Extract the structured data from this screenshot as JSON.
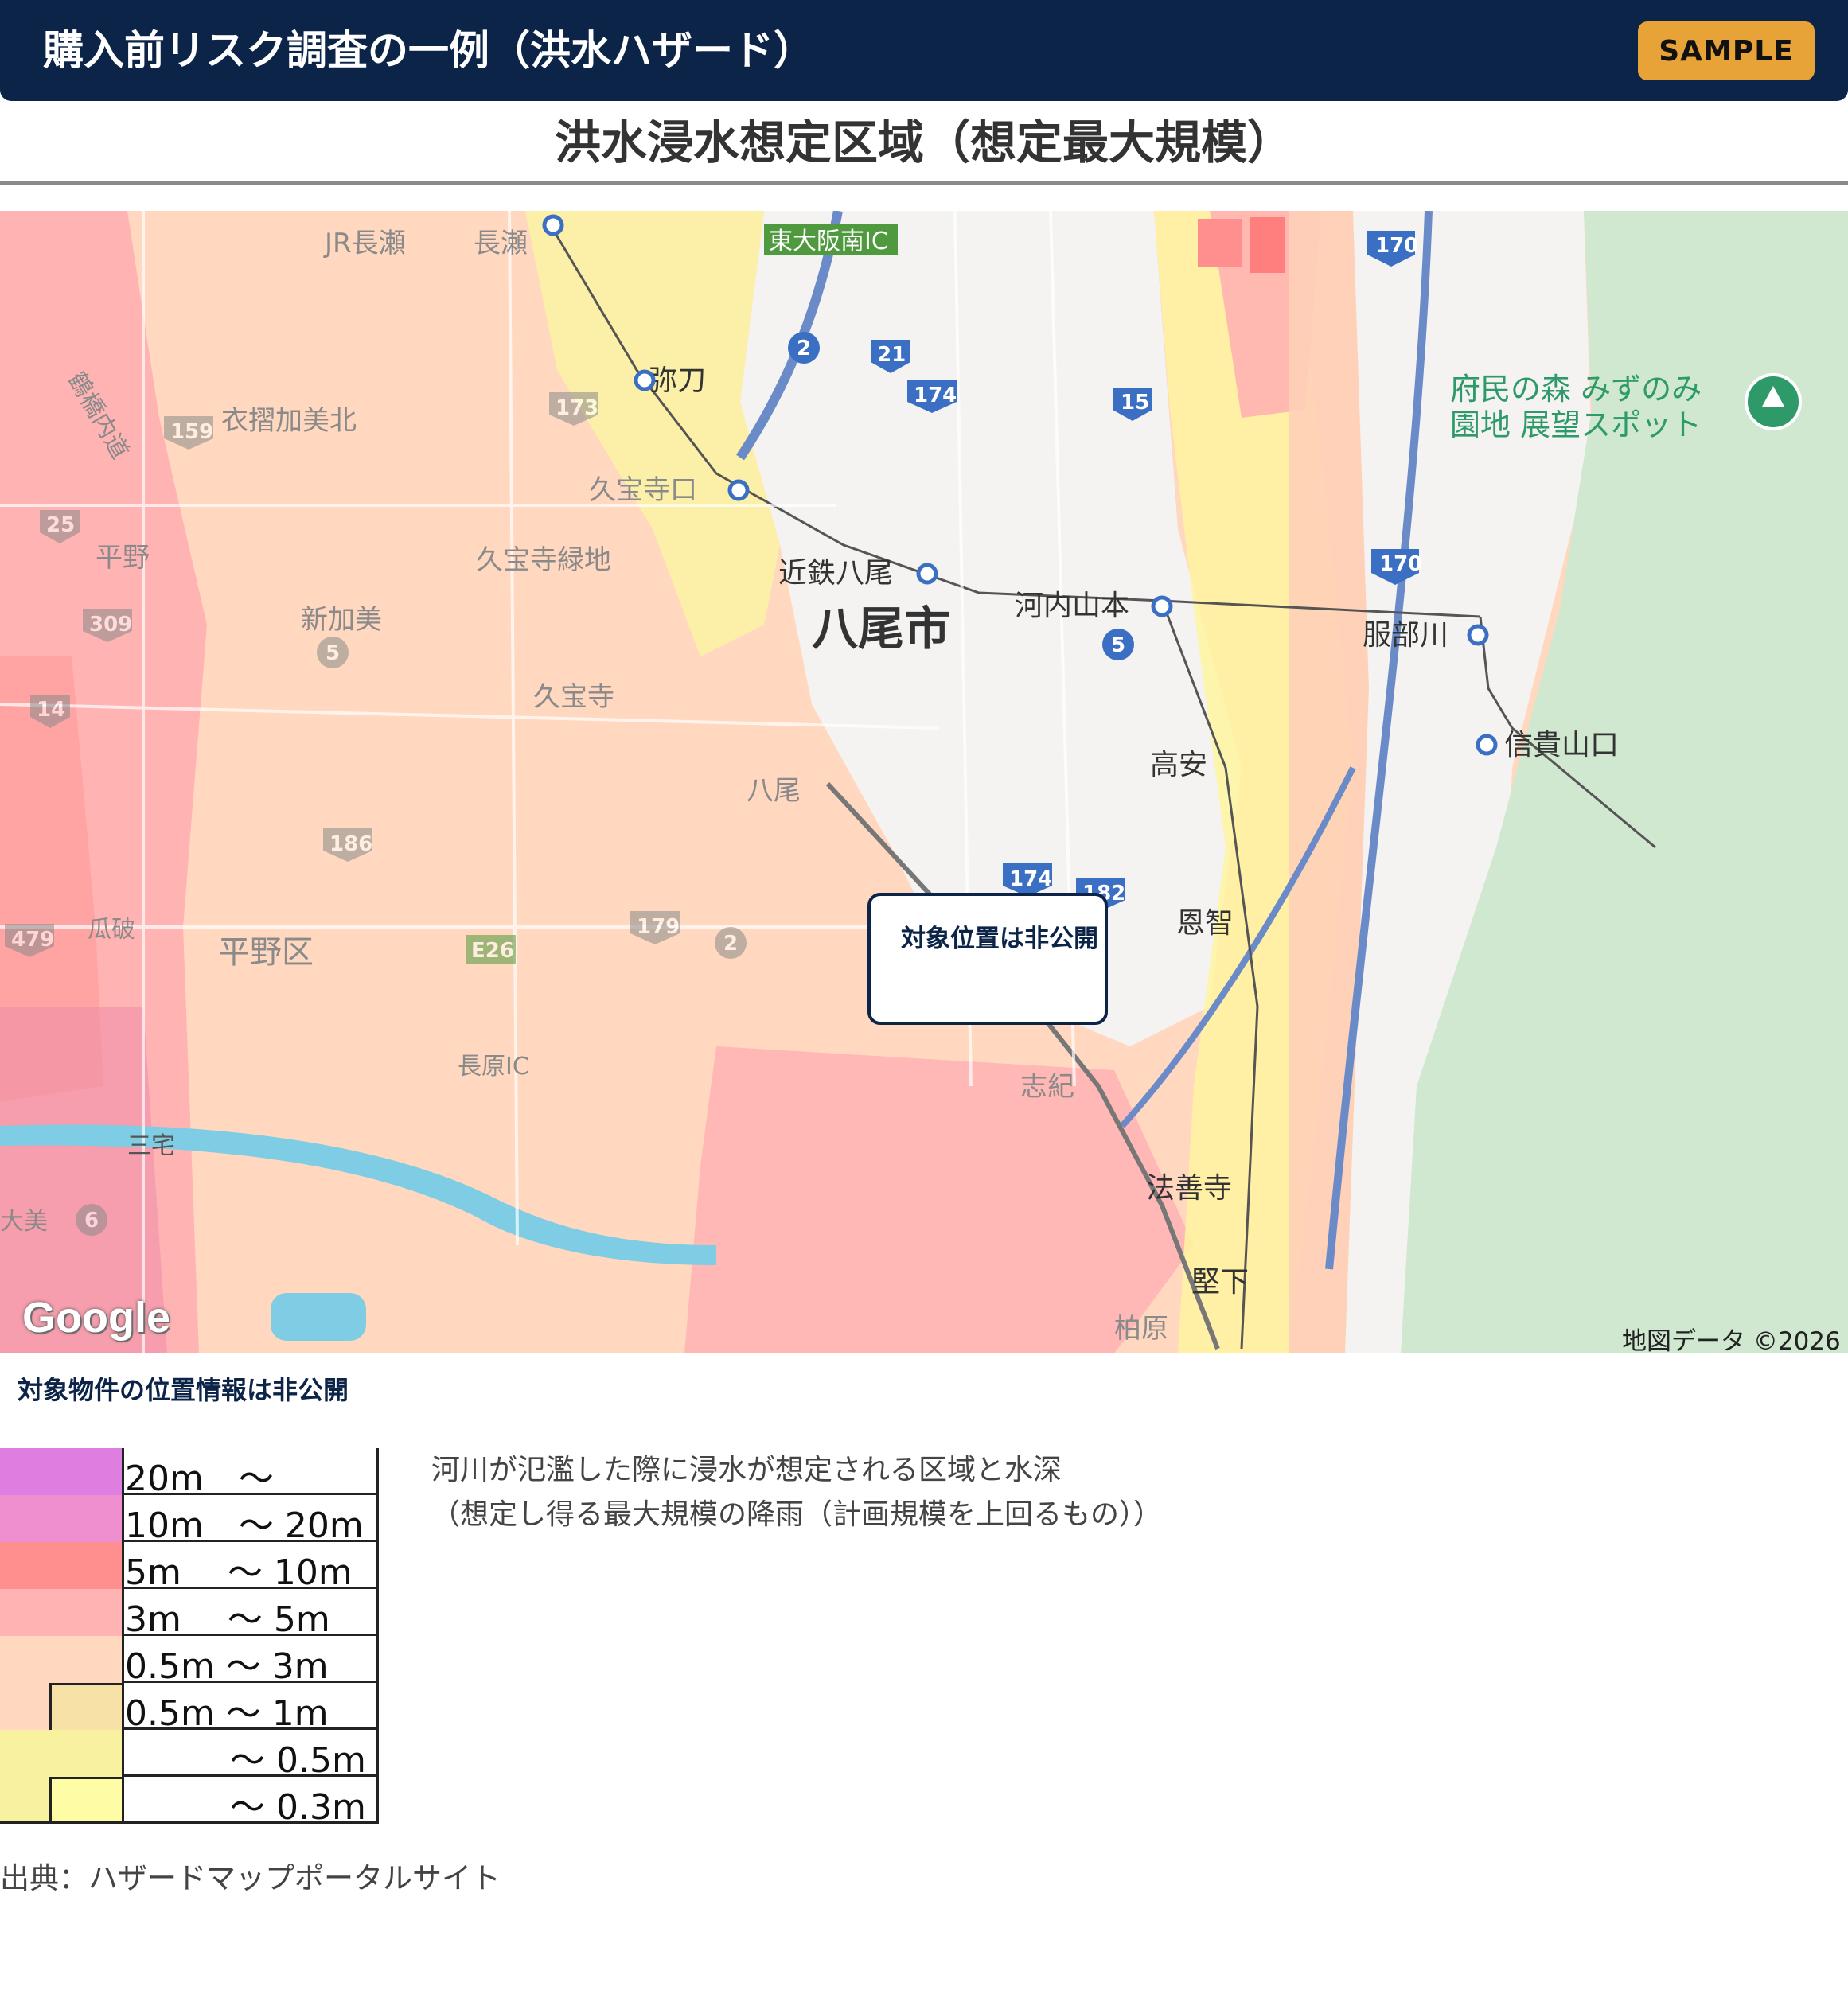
{
  "header": {
    "title": "購入前リスク調査の一例（洪水ハザード）",
    "badge": "SAMPLE",
    "bg_color": "#0b2447",
    "badge_color": "#e8a338"
  },
  "page_title": "洪水浸水想定区域（想定最大規模）",
  "map": {
    "private_box_label": "対象位置は非公開",
    "attribution": "地図データ ©2026",
    "logo": "Google",
    "place_labels": [
      "JR長瀬",
      "長瀬",
      "東大阪南IC",
      "弥刀",
      "衣摺加美北",
      "久宝寺口",
      "平野",
      "久宝寺緑地",
      "近鉄八尾",
      "河内山本",
      "服部川",
      "八尾市",
      "新加美",
      "久宝寺",
      "八尾",
      "高安",
      "信貴山口",
      "府民の森 みずのみ",
      "園地 展望スポット",
      "瓜破",
      "平野区",
      "恩智",
      "長原IC",
      "志紀",
      "法善寺",
      "堅下",
      "柏原",
      "三宅",
      "大美",
      "鶴橋内道"
    ],
    "route_numbers": [
      "170",
      "2",
      "21",
      "174",
      "15",
      "159",
      "173",
      "25",
      "309",
      "5",
      "14",
      "186",
      "179",
      "479",
      "E26",
      "6",
      "174",
      "182"
    ],
    "zone_colors": {
      "over_20m": "#dd7ee0",
      "10m_20m": "#f08fd0",
      "5m_10m": "#ff8f8f",
      "3m_5m": "#ffb3b3",
      "05m_3m": "#ffd8bf",
      "05m_1m": "#f8e1a6",
      "under_05m": "#f8f2a0",
      "under_03m": "#fffca6"
    }
  },
  "position_note": "対象物件の位置情報は非公開",
  "legend": {
    "rows": [
      {
        "label": "20m　～",
        "color": "#dd7ee0"
      },
      {
        "label": "10m　～ 20m",
        "color": "#f08fd0"
      },
      {
        "label": "5m　 ～ 10m",
        "color": "#ff8f8f"
      },
      {
        "label": "3m　 ～ 5m",
        "color": "#ffb3b3"
      },
      {
        "label": "0.5m ～ 3m",
        "color": "#ffd8bf"
      },
      {
        "label": "0.5m ～ 1m",
        "color": "#f8e1a6"
      },
      {
        "label": "　　　～ 0.5m",
        "color": "#f8f2a0"
      },
      {
        "label": "　　　～ 0.3m",
        "color": "#fffca6"
      }
    ]
  },
  "description": {
    "line1": "河川が氾濫した際に浸水が想定される区域と水深",
    "line2": "（想定し得る最大規模の降雨（計画規模を上回るもの））"
  },
  "source": "出典：ハザードマップポータルサイト"
}
